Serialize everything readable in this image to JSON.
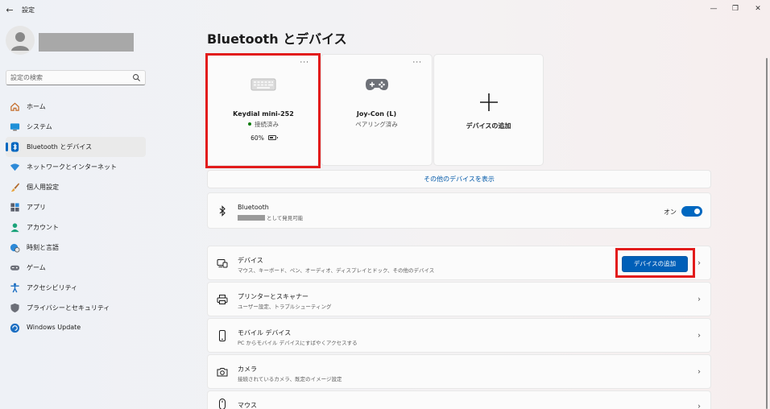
{
  "window": {
    "app_title": "設定",
    "back_glyph": "←",
    "min_glyph": "—",
    "max_glyph": "❐",
    "close_glyph": "✕"
  },
  "sidebar": {
    "search_placeholder": "設定の検索",
    "items": [
      {
        "label": "ホーム",
        "icon": "home-icon"
      },
      {
        "label": "システム",
        "icon": "system-icon"
      },
      {
        "label": "Bluetooth とデバイス",
        "icon": "bluetooth-icon",
        "active": true
      },
      {
        "label": "ネットワークとインターネット",
        "icon": "wifi-icon"
      },
      {
        "label": "個人用設定",
        "icon": "brush-icon"
      },
      {
        "label": "アプリ",
        "icon": "apps-icon"
      },
      {
        "label": "アカウント",
        "icon": "account-icon"
      },
      {
        "label": "時刻と言語",
        "icon": "globe-clock-icon"
      },
      {
        "label": "ゲーム",
        "icon": "gamepad-icon"
      },
      {
        "label": "アクセシビリティ",
        "icon": "accessibility-icon"
      },
      {
        "label": "プライバシーとセキュリティ",
        "icon": "shield-icon"
      },
      {
        "label": "Windows Update",
        "icon": "update-icon"
      }
    ]
  },
  "main": {
    "title": "Bluetooth とデバイス",
    "devices": [
      {
        "name": "Keydial mini-252",
        "status": "接続済み",
        "battery": "60%",
        "more": "···",
        "icon": "keyboard-icon",
        "battery_level": 0.6
      },
      {
        "name": "Joy-Con (L)",
        "status": "ペアリング済み",
        "more": "···",
        "icon": "gamepad-icon"
      }
    ],
    "add_device_card": {
      "label": "デバイスの追加",
      "icon": "plus-icon"
    },
    "show_more": "その他のデバイスを表示",
    "bluetooth_row": {
      "title": "Bluetooth",
      "subtitle_suffix": "として発見可能",
      "toggle_label": "オン",
      "toggle_on": true
    },
    "rows": [
      {
        "title": "デバイス",
        "subtitle": "マウス、キーボード、ペン、オーディオ、ディスプレイとドック、その他のデバイス",
        "button": "デバイスの追加",
        "icon": "devices-icon"
      },
      {
        "title": "プリンターとスキャナー",
        "subtitle": "ユーザー設定、トラブルシューティング",
        "icon": "printer-icon"
      },
      {
        "title": "モバイル デバイス",
        "subtitle": "PC からモバイル デバイスにすばやくアクセスする",
        "icon": "phone-icon"
      },
      {
        "title": "カメラ",
        "subtitle": "接続されているカメラ、既定のイメージ設定",
        "icon": "camera-icon"
      },
      {
        "title": "マウス",
        "subtitle": "",
        "icon": "mouse-icon"
      }
    ],
    "chevron_glyph": "›"
  },
  "colors": {
    "accent": "#005fb8",
    "highlight": "#e21c1c",
    "connected_dot": "#0f7b0f"
  }
}
